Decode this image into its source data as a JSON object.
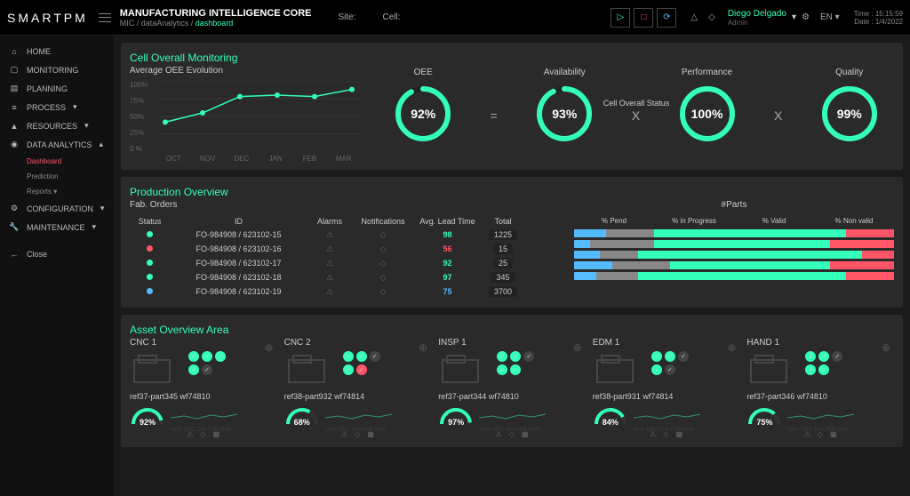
{
  "header": {
    "logo": "SMARTPM",
    "title": "MANUFACTURING INTELLIGENCE CORE",
    "breadcrumb_pre": "MIC / dataAnalytics / ",
    "breadcrumb_cur": "dashboard",
    "site_lbl": "Site:",
    "cell_lbl": "Cell:",
    "user_name": "Diego Delgado",
    "user_role": "Admin",
    "lang": "EN",
    "time_lbl": "Time : 15:15:59",
    "date_lbl": "Date : 1/4/2022"
  },
  "nav": {
    "home": "HOME",
    "monitoring": "MONITORING",
    "planning": "PLANNING",
    "process": "PROCESS",
    "resources": "RESOURCES",
    "analytics": "DATA ANALYTICS",
    "dashboard": "Dashboard",
    "prediction": "Prediction",
    "reports": "Reports",
    "config": "CONFIGURATION",
    "maint": "MAINTENANCE",
    "close": "Close"
  },
  "monitoring": {
    "title": "Cell Overall Monitoring",
    "subtitle": "Average OEE Evolution",
    "status_title": "Cell Overall Status",
    "oee": {
      "lbl": "OEE",
      "val": "92%"
    },
    "avail": {
      "lbl": "Availability",
      "val": "93%"
    },
    "perf": {
      "lbl": "Performance",
      "val": "100%"
    },
    "qual": {
      "lbl": "Quality",
      "val": "99%"
    }
  },
  "chart_data": {
    "type": "line",
    "title": "Average OEE Evolution",
    "ylabel": "%",
    "ylim": [
      0,
      100
    ],
    "categories": [
      "OCT",
      "NOV",
      "DEC",
      "JAN",
      "FEB",
      "MAR"
    ],
    "y_ticks": [
      "0 %",
      "25%",
      "50%",
      "75%",
      "100%"
    ],
    "values": [
      42,
      55,
      78,
      80,
      78,
      88
    ]
  },
  "production": {
    "title": "Production Overview",
    "fab_title": "Fab. Orders",
    "parts_title": "#Parts",
    "cols": {
      "status": "Status",
      "id": "ID",
      "alarms": "Alarms",
      "notif": "Notifications",
      "lead": "Avg. Lead Time",
      "total": "Total",
      "pend": "% Pend",
      "prog": "% in Progress",
      "valid": "% Valid",
      "nonv": "% Non valid"
    },
    "rows": [
      {
        "status": "g",
        "id": "FO-984908 / 623102-15",
        "lead": "98",
        "lc": "g",
        "total": "1225",
        "p": 10,
        "i": 15,
        "v": 60,
        "n": 15
      },
      {
        "status": "r",
        "id": "FO-984908 / 623102-16",
        "lead": "56",
        "lc": "r",
        "total": "15",
        "p": 5,
        "i": 20,
        "v": 55,
        "n": 20
      },
      {
        "status": "g",
        "id": "FO-984908 / 623102-17",
        "lead": "92",
        "lc": "g",
        "total": "25",
        "p": 8,
        "i": 12,
        "v": 70,
        "n": 10
      },
      {
        "status": "g",
        "id": "FO-984908 / 623102-18",
        "lead": "97",
        "lc": "g",
        "total": "345",
        "p": 12,
        "i": 18,
        "v": 50,
        "n": 20
      },
      {
        "status": "b",
        "id": "FO-984908 / 623102-19",
        "lead": "75",
        "lc": "b",
        "total": "3700",
        "p": 7,
        "i": 13,
        "v": 65,
        "n": 15
      }
    ]
  },
  "assets": {
    "title": "Asset Overview Area",
    "months": "NOV DEC JAN FEB MAR",
    "items": [
      {
        "name": "CNC 1",
        "ref": "ref37-part345 wf74810",
        "val": "92%",
        "ind": [
          "g",
          "g",
          "g",
          "g",
          "d"
        ]
      },
      {
        "name": "CNC 2",
        "ref": "ref38-part932 wf74814",
        "val": "68%",
        "ind": [
          "g",
          "g",
          "d",
          "g",
          "r"
        ]
      },
      {
        "name": "INSP 1",
        "ref": "ref37-part344 wf74810",
        "val": "97%",
        "ind": [
          "g",
          "g",
          "d",
          "g",
          "g"
        ]
      },
      {
        "name": "EDM 1",
        "ref": "ref38-part931 wf74814",
        "val": "84%",
        "ind": [
          "g",
          "g",
          "d",
          "g",
          "d"
        ]
      },
      {
        "name": "HAND 1",
        "ref": "ref37-part346 wf74810",
        "val": "75%",
        "ind": [
          "g",
          "g",
          "d",
          "g",
          "g"
        ]
      }
    ]
  }
}
